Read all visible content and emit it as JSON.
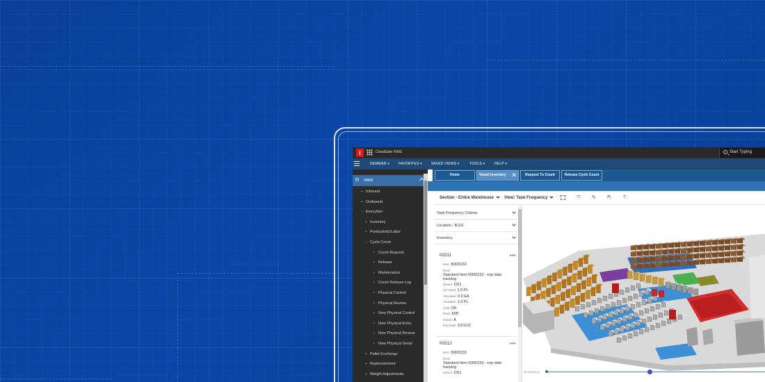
{
  "topbar": {
    "logo": "i",
    "app_title": "CloudSuite WMS",
    "search_placeholder": "Start Typing"
  },
  "menu": {
    "items": [
      "DEMWEB ▾",
      "FAVORITES ▾",
      "SAVED VIEWS ▾",
      "TOOLS ▾",
      "HELP ▾"
    ]
  },
  "sidebar": {
    "search_label": "WMS",
    "items": [
      {
        "marker": "+",
        "label": "Inbound",
        "level": 1
      },
      {
        "marker": "+",
        "label": "Outbound",
        "level": 1
      },
      {
        "marker": "–",
        "label": "Execution",
        "level": 1
      },
      {
        "marker": "+",
        "label": "Inventory",
        "level": 2
      },
      {
        "marker": "+",
        "label": "Productivity/Labor",
        "level": 2
      },
      {
        "marker": "–",
        "label": "Cycle Count",
        "level": 2
      },
      {
        "marker": "•",
        "label": "Count Request",
        "level": 3
      },
      {
        "marker": "•",
        "label": "Release",
        "level": 3
      },
      {
        "marker": "•",
        "label": "Maintenance",
        "level": 3
      },
      {
        "marker": "•",
        "label": "Count Release Log",
        "level": 3
      },
      {
        "marker": "•",
        "label": "Physical Control",
        "level": 3
      },
      {
        "marker": "•",
        "label": "Physical Review",
        "level": 3
      },
      {
        "marker": "•",
        "label": "New Physical Control",
        "level": 3
      },
      {
        "marker": "•",
        "label": "New Physical Entry",
        "level": 3
      },
      {
        "marker": "•",
        "label": "New Physical Review",
        "level": 3
      },
      {
        "marker": "•",
        "label": "New Physical Serial",
        "level": 3
      },
      {
        "marker": "+",
        "label": "Pallet Exchange",
        "level": 2
      },
      {
        "marker": "+",
        "label": "Replenishment",
        "level": 2
      },
      {
        "marker": "+",
        "label": "Weight Adjustments",
        "level": 2
      }
    ]
  },
  "tabs": [
    {
      "label": "Home",
      "active": false
    },
    {
      "label": "Visual Inventory",
      "active": true,
      "close": "✕"
    },
    {
      "label": "Request To Count",
      "active": false
    },
    {
      "label": "Release Cycle Count",
      "active": false
    }
  ],
  "toolbar": {
    "section": "Section - Entire Warehouse",
    "view": "View: Task Frequency",
    "icons": [
      "fit-icon",
      "reset-icon",
      "refresh-icon",
      "export-icon",
      "help-icon"
    ],
    "help_glyph": "?"
  },
  "panel": {
    "accordions": [
      "Task Frequency Criteria",
      "Location - B119",
      "Inventory"
    ],
    "cards": [
      {
        "id": "N3211",
        "menu": "•••",
        "item_key": "Item:",
        "item": "N300233",
        "desc_key": "Desc:",
        "desc": "Standard Item N300233 - exp date tracking",
        "owner_key": "Owner:",
        "owner": "DS1",
        "onhand_key": "On Hand:",
        "onhand": "1.0 PL",
        "allocated_key": "Allocated:",
        "allocated": "0.0 EA",
        "available_key": "Available:",
        "available": "1.0 PL",
        "hold_key": "Hold:",
        "hold": "OK",
        "pack_key": "Pack:",
        "pack": "80P",
        "grade_key": "Grade:",
        "grade": "A",
        "exp_key": "Exp Date:",
        "exp": "10/1/15"
      },
      {
        "id": "N3212",
        "menu": "•••",
        "item_key": "Item:",
        "item": "N300233",
        "desc_key": "Desc:",
        "desc": "Standard Item N300233 - exp date tracking",
        "owner_key": "Owner:",
        "owner": "DS1"
      }
    ]
  },
  "view3d": {
    "slider_label": "NO DATA (0.0)"
  },
  "colors": {
    "background": "#0b47a8",
    "menubar": "#1f4a75",
    "tabbar": "#1d5a8f",
    "sidebar": "#2b2b2b",
    "logo": "#d71920"
  }
}
